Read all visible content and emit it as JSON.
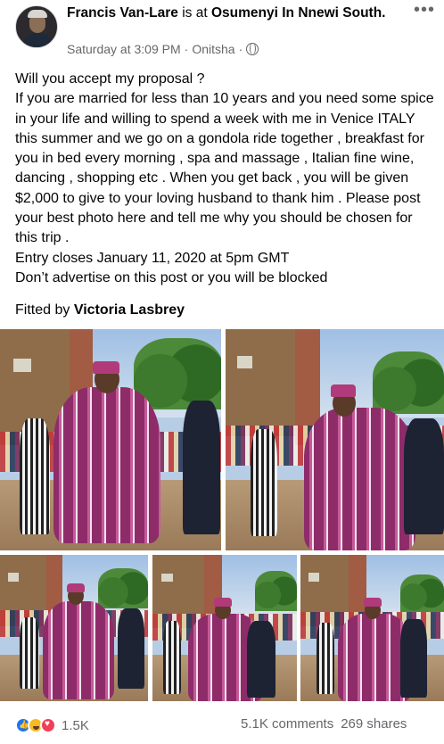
{
  "post": {
    "author": "Francis Van-Lare",
    "is_at": "is at",
    "place": "Osumenyi In Nnewi South.",
    "time": "Saturday at 3:09 PM",
    "location": "Onitsha",
    "separator": "·",
    "text": "Will you accept my proposal ?\nIf you are married for less than 10 years and you need some spice in your life and willing to spend a week with me in Venice ITALY this summer and we go on a gondola ride together , breakfast for you in bed every morning , spa and massage , Italian fine wine, dancing , shopping etc . When you get back , you will be given $2,000 to give to your loving husband to thank him . Please post your best photo here and tell me why you should be chosen for this trip .\nEntry closes January 11, 2020 at 5pm GMT\nDon’t advertise on this post or you will be blocked",
    "credit_prefix": "Fitted by",
    "credit_name": "Victoria Lasbrey"
  },
  "icons": {
    "more": "more-options-icon",
    "globe": "globe-icon",
    "reactions": [
      "like-icon",
      "haha-icon",
      "love-icon"
    ]
  },
  "footer": {
    "reaction_count": "1.5K",
    "comments": "5.1K comments",
    "shares": "269 shares"
  },
  "colors": {
    "secondary_text": "#65676b",
    "like": "#1877f2",
    "love": "#f33e58",
    "haha": "#f7b928"
  }
}
